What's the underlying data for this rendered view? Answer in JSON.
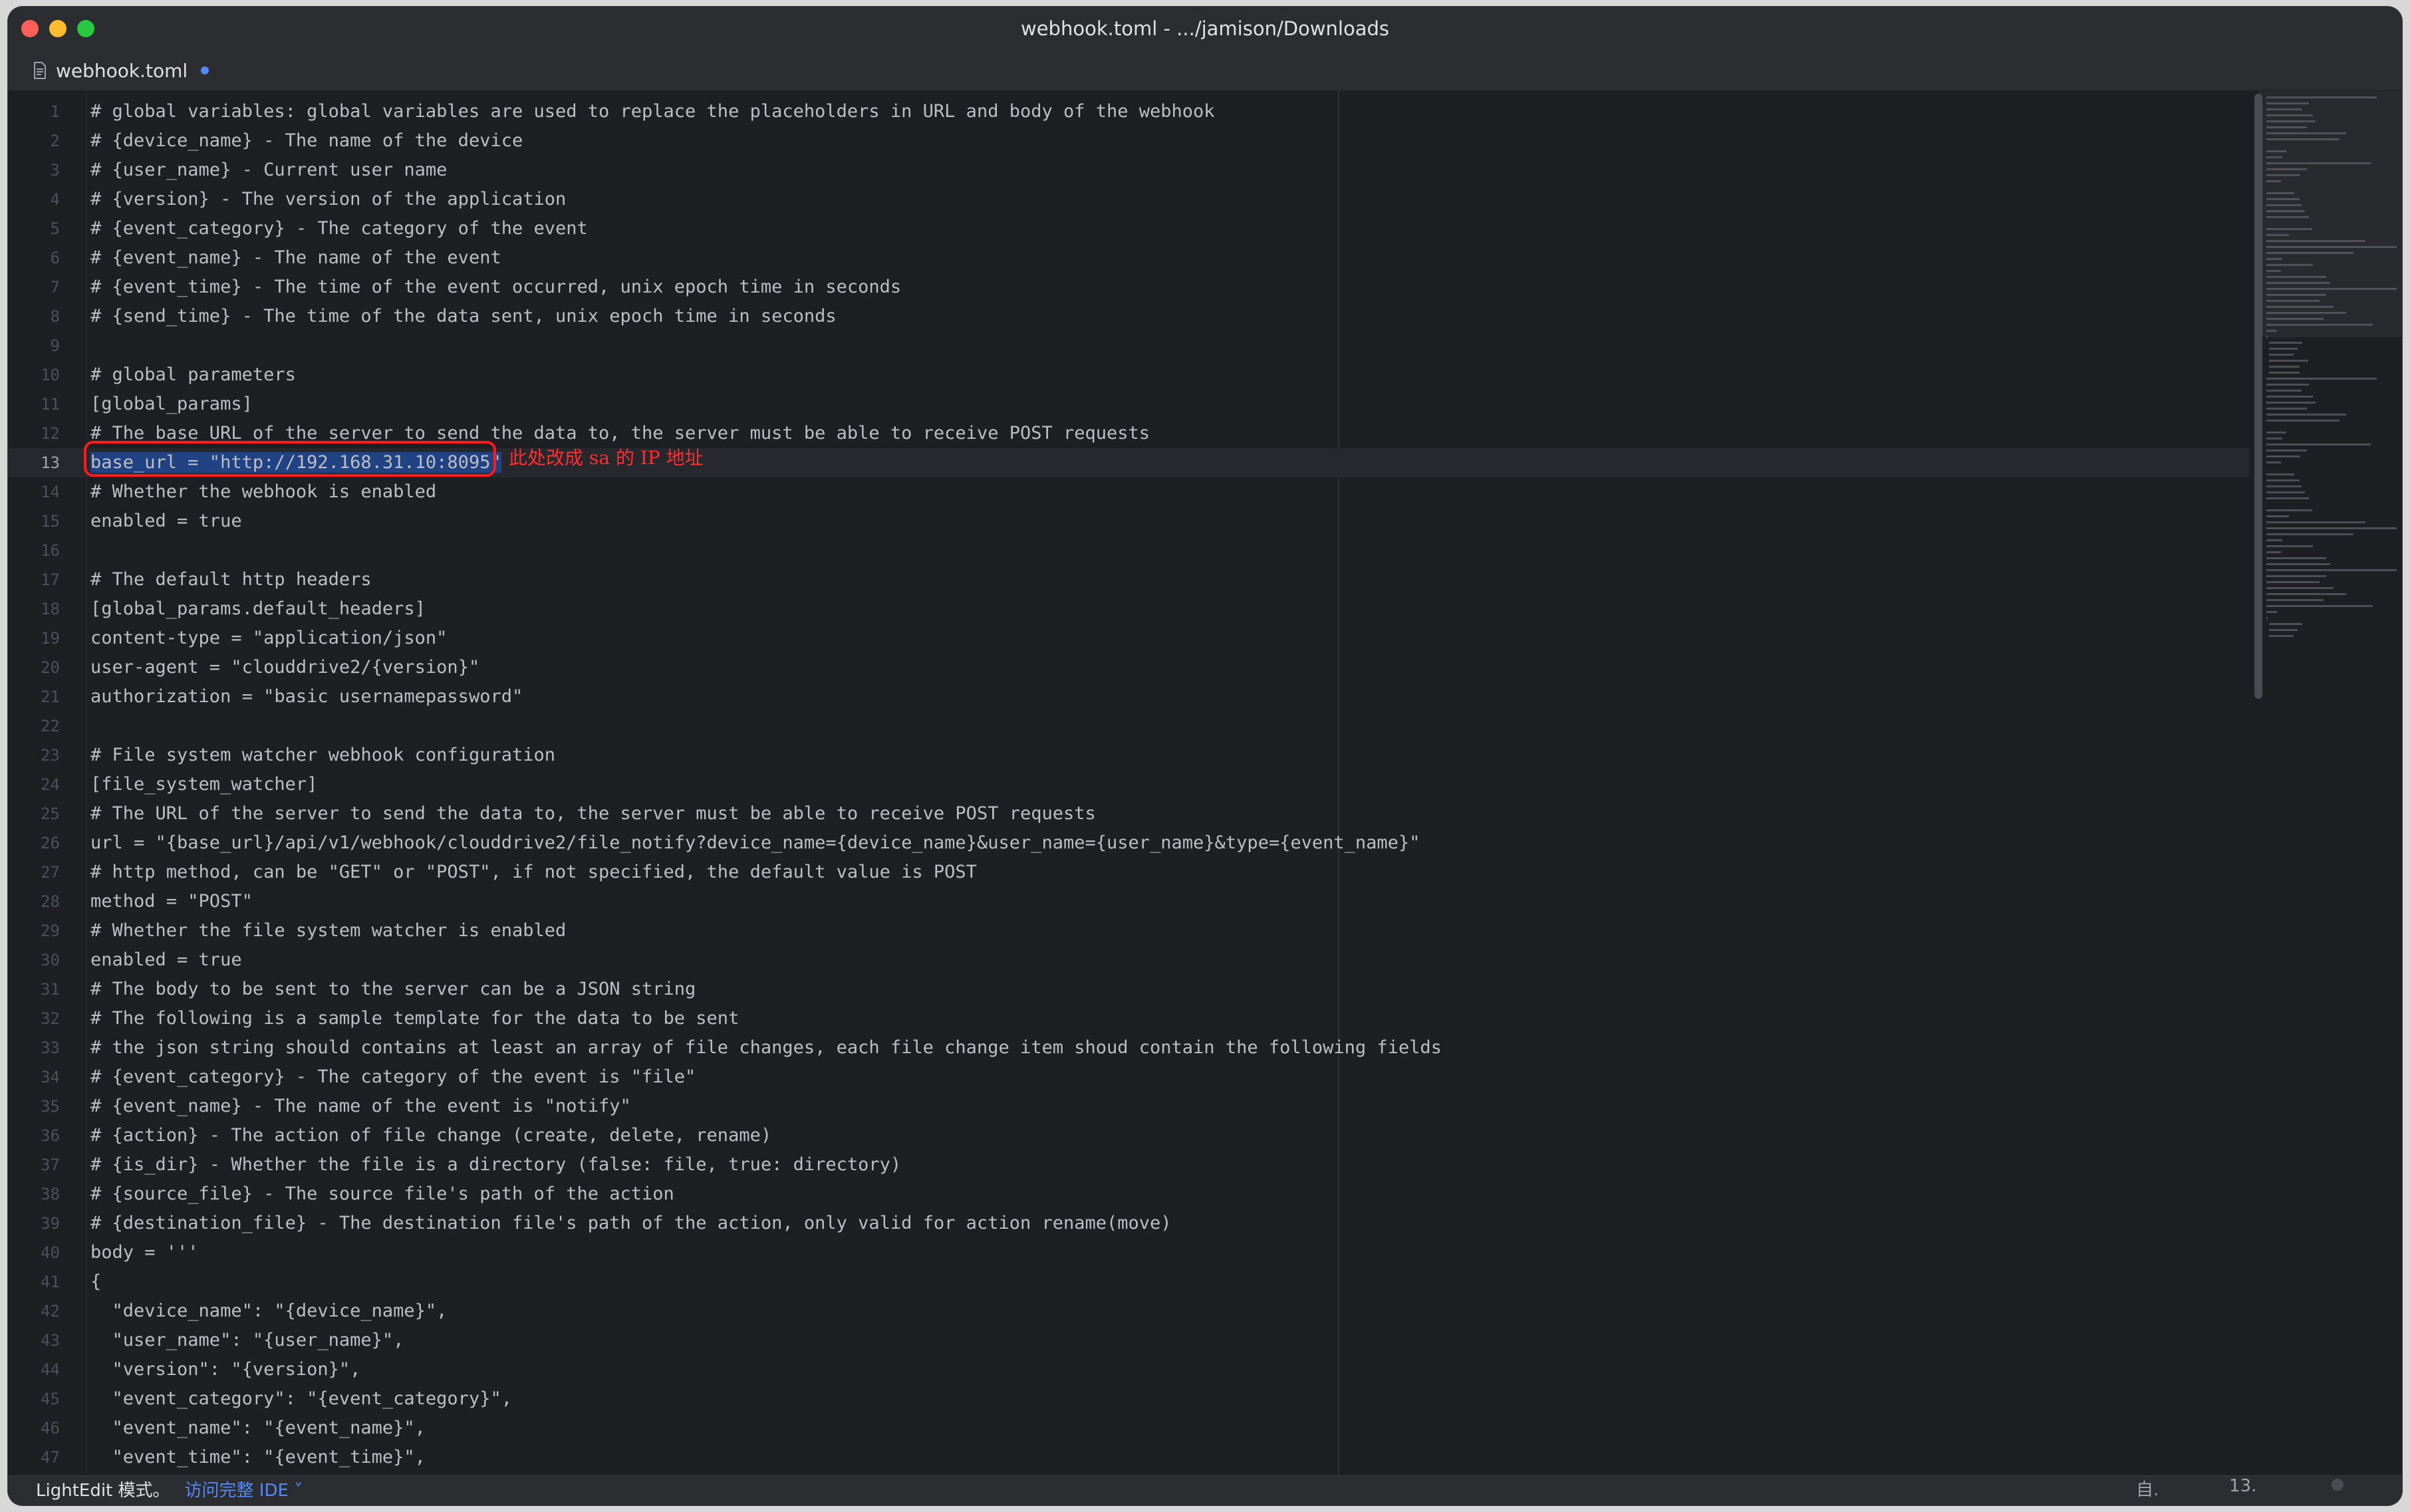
{
  "window": {
    "title": "webhook.toml - .../jamison/Downloads"
  },
  "tab": {
    "label": "webhook.toml",
    "modified": true
  },
  "editor": {
    "current_line": 13,
    "annotation": "此处改成 sa 的 IP 地址",
    "lines": [
      "# global variables: global variables are used to replace the placeholders in URL and body of the webhook",
      "# {device_name} - The name of the device",
      "# {user_name} - Current user name",
      "# {version} - The version of the application",
      "# {event_category} - The category of the event",
      "# {event_name} - The name of the event",
      "# {event_time} - The time of the event occurred, unix epoch time in seconds",
      "# {send_time} - The time of the data sent, unix epoch time in seconds",
      "",
      "# global parameters",
      "[global_params]",
      "# The base URL of the server to send the data to, the server must be able to receive POST requests",
      "base_url = \"http://192.168.31.10:8095\"",
      "# Whether the webhook is enabled",
      "enabled = true",
      "",
      "# The default http headers",
      "[global_params.default_headers]",
      "content-type = \"application/json\"",
      "user-agent = \"clouddrive2/{version}\"",
      "authorization = \"basic usernamepassword\"",
      "",
      "# File system watcher webhook configuration",
      "[file_system_watcher]",
      "# The URL of the server to send the data to, the server must be able to receive POST requests",
      "url = \"{base_url}/api/v1/webhook/clouddrive2/file_notify?device_name={device_name}&user_name={user_name}&type={event_name}\"",
      "# http method, can be \"GET\" or \"POST\", if not specified, the default value is POST",
      "method = \"POST\"",
      "# Whether the file system watcher is enabled",
      "enabled = true",
      "# The body to be sent to the server can be a JSON string",
      "# The following is a sample template for the data to be sent",
      "# the json string should contains at least an array of file changes, each file change item shoud contain the following fields",
      "# {event_category} - The category of the event is \"file\"",
      "# {event_name} - The name of the event is \"notify\"",
      "# {action} - The action of file change (create, delete, rename)",
      "# {is_dir} - Whether the file is a directory (false: file, true: directory)",
      "# {source_file} - The source file's path of the action",
      "# {destination_file} - The destination file's path of the action, only valid for action rename(move)",
      "body = '''",
      "{",
      "  \"device_name\": \"{device_name}\",",
      "  \"user_name\": \"{user_name}\",",
      "  \"version\": \"{version}\",",
      "  \"event_category\": \"{event_category}\",",
      "  \"event_name\": \"{event_name}\",",
      "  \"event_time\": \"{event_time}\","
    ]
  },
  "statusbar": {
    "mode_label": "LightEdit 模式。",
    "ide_link": "访问完整 IDE",
    "ide_chevron": "˅",
    "encoding_label": "自.",
    "position_label": "13."
  },
  "colors": {
    "background": "#1e1f22",
    "selection": "#214283",
    "annotation_red": "#ff1a1a",
    "link_blue": "#548af7"
  }
}
